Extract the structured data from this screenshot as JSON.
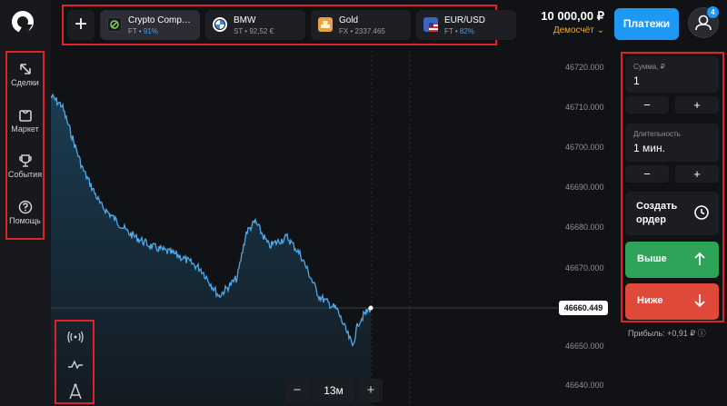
{
  "sidebar": {
    "items": [
      {
        "label": "Сделки",
        "icon": "trades-icon"
      },
      {
        "label": "Маркет",
        "icon": "market-icon"
      },
      {
        "label": "События",
        "icon": "trophy-icon"
      },
      {
        "label": "Помощь",
        "icon": "help-icon"
      }
    ]
  },
  "topbar": {
    "add_label": "+",
    "assets": [
      {
        "name": "Crypto Comp…",
        "sub_prefix": "FT • ",
        "sub_value": "91%",
        "color": "#1a1a1a"
      },
      {
        "name": "BMW",
        "sub_prefix": "ST • 92,52 €",
        "sub_value": "",
        "color": "#ffffff"
      },
      {
        "name": "Gold",
        "sub_prefix": "FX • 2337.465",
        "sub_value": "",
        "color": "#e8a244"
      },
      {
        "name": "EUR/USD",
        "sub_prefix": "FT • ",
        "sub_value": "82%",
        "color": "#3b66c4"
      }
    ],
    "balance": "10 000,00 ₽",
    "account_type": "Демосчёт ⌄",
    "payments_label": "Платежи",
    "notifications_count": "4"
  },
  "chart": {
    "y_ticks": [
      "46720.000",
      "46710.000",
      "46700.000",
      "46690.000",
      "46680.000",
      "46670.000",
      "46660.449",
      "46650.000",
      "46640.000"
    ],
    "current_price": "46660.449",
    "line_color": "#4fa8e8",
    "zoom_minus": "−",
    "zoom_value": "13м",
    "zoom_plus": "+"
  },
  "trade": {
    "amount_label": "Сумма, ₽",
    "amount_value": "1",
    "minus": "−",
    "plus": "+",
    "duration_label": "Длительность",
    "duration_value": "1 мин.",
    "order_label": "Создать ордер",
    "up_label": "Выше",
    "down_label": "Ниже",
    "profit": "Прибыль: +0,91 ₽ ⓘ"
  }
}
